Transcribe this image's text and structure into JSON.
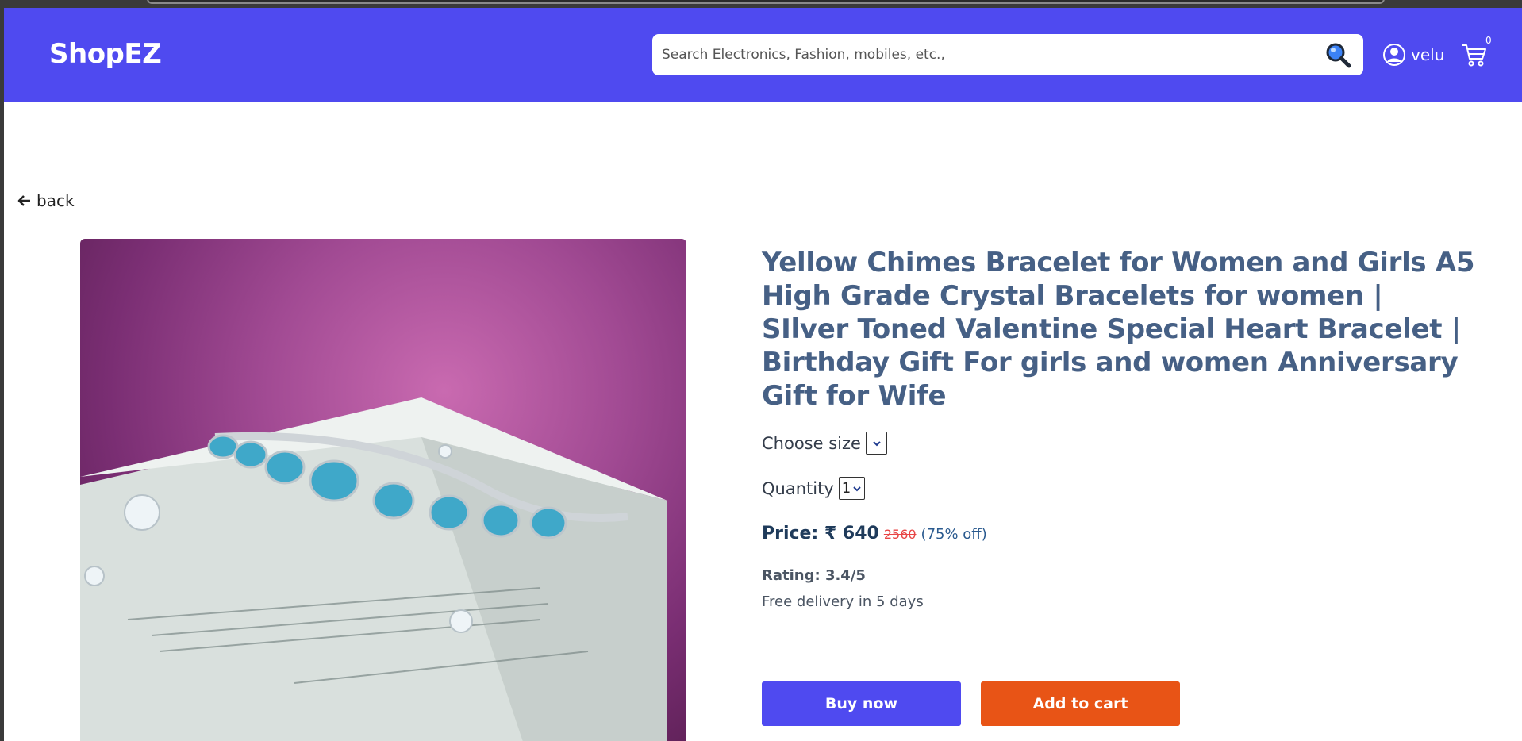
{
  "navbar": {
    "brand": "ShopEZ",
    "search_placeholder": "Search Electronics, Fashion, mobiles, etc.,",
    "username": "velu",
    "cart_count": "0"
  },
  "back": {
    "label": "back"
  },
  "product": {
    "image_icon": "bracelet-product-photo",
    "title": "Yellow Chimes Bracelet for Women and Girls A5 High Grade Crystal Bracelets for women | SIlver Toned Valentine Special Heart Bracelet | Birthday Gift For girls and women Anniversary Gift for Wife",
    "size_label": "Choose size",
    "size_value": "",
    "quantity_label": "Quantity",
    "quantity_value": "1",
    "price_label": "Price: ₹ 640",
    "original_price": "2560",
    "discount": "(75% off)",
    "rating": "Rating: 3.4/5",
    "delivery": "Free delivery in 5 days"
  },
  "actions": {
    "buy_now": "Buy now",
    "add_to_cart": "Add to cart"
  },
  "colors": {
    "navbar": "#4f4af0",
    "buy_button": "#4f4af0",
    "cart_button": "#e85416",
    "title": "#466085"
  }
}
